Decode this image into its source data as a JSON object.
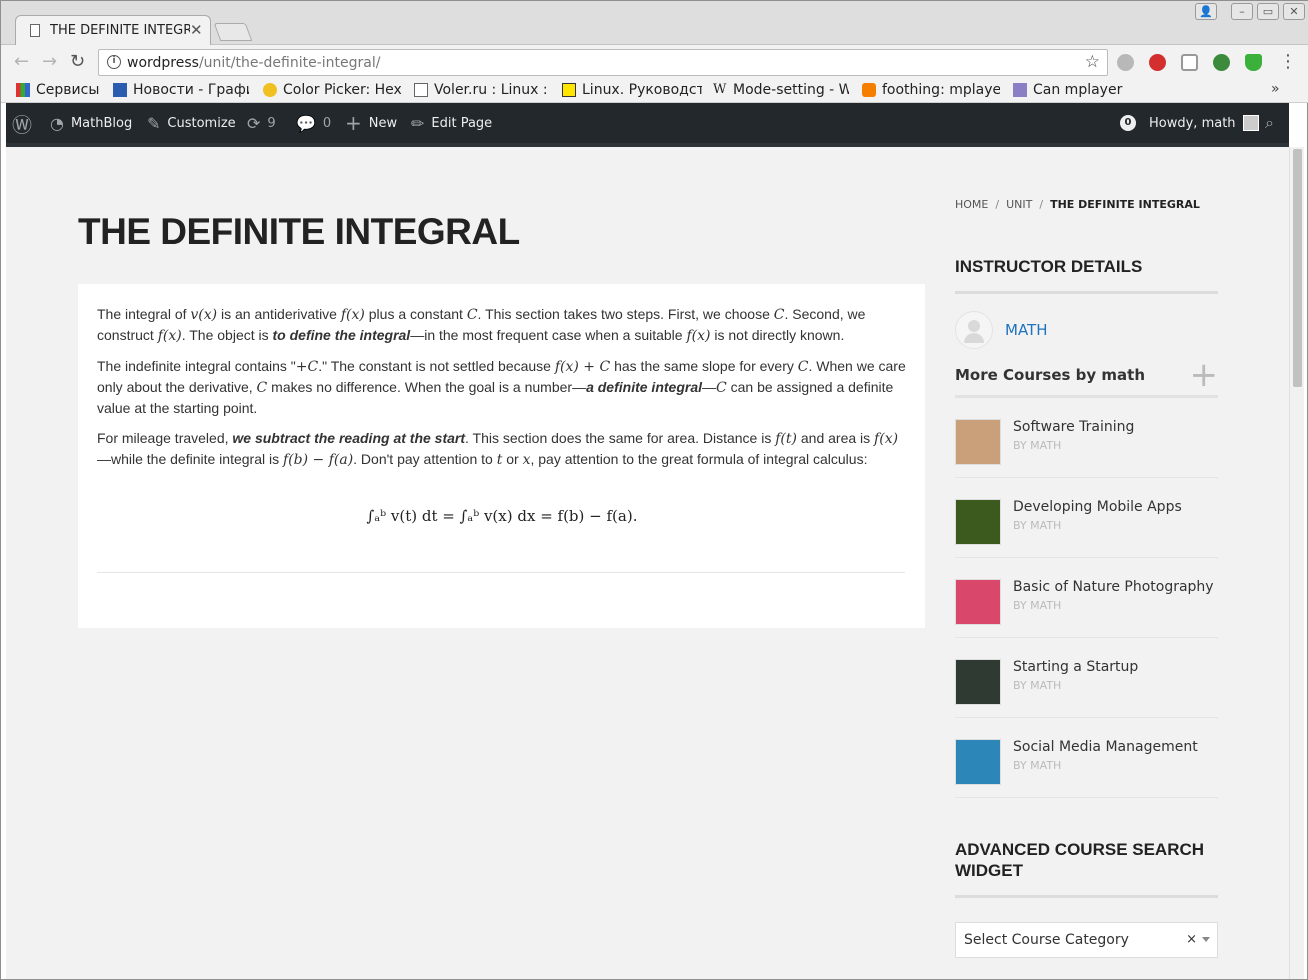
{
  "browser": {
    "tab_title": "THE DEFINITE INTEGRAL",
    "url_host": "wordpress",
    "url_path": "/unit/the-definite-integral/",
    "bookmarks": [
      {
        "label": "Сервисы",
        "icon": "apps-grid-icon"
      },
      {
        "label": "Новости - Графи",
        "icon": "news-icon"
      },
      {
        "label": "Color Picker: Hex",
        "icon": "color-picker-icon"
      },
      {
        "label": "Voler.ru : Linux : I",
        "icon": "page-icon"
      },
      {
        "label": "Linux. Руководст",
        "icon": "linux-l-icon"
      },
      {
        "label": "Mode-setting - W",
        "icon": "wikipedia-icon"
      },
      {
        "label": "foothing: mplaye",
        "icon": "blogger-icon"
      },
      {
        "label": "Can mplayer play",
        "icon": "page-icon"
      }
    ]
  },
  "adminbar": {
    "site_name": "MathBlog",
    "customize": "Customize",
    "updates_count": "9",
    "comments_count": "0",
    "new_label": "New",
    "edit_label": "Edit Page",
    "notifications_count": "0",
    "howdy": "Howdy, math"
  },
  "page": {
    "title": "THE DEFINITE INTEGRAL",
    "breadcrumb": {
      "home": "HOME",
      "unit": "UNIT",
      "current": "THE DEFINITE INTEGRAL"
    },
    "content": {
      "p1": {
        "t1": "The integral of ",
        "m1": "v(x)",
        "t2": " is an antiderivative ",
        "m2": "f(x)",
        "t3": " plus a constant ",
        "m3": "C",
        "t4": ". This section takes two steps. First, we choose ",
        "m4": "C",
        "t5": ". Second, we construct ",
        "m5": "f(x)",
        "t6": ". The object is ",
        "em1": "to define the integral",
        "t7": "—in the most frequent case when a suitable ",
        "m6": "f(x)",
        "t8": " is not directly known."
      },
      "p2": {
        "t1": "The indefinite integral contains \"",
        "m1": "+C",
        "t2": ".\" The constant is not settled because ",
        "m2": "f(x) + C",
        "t3": " has the same slope for every ",
        "m3": "C",
        "t4": ". When we care only about the derivative, ",
        "m4": "C",
        "t5": " makes no difference. When the goal is a number—",
        "em1": "a definite integral",
        "t6": "—",
        "m5": "C",
        "t7": " can be assigned a definite value at the starting point."
      },
      "p3": {
        "t1": "For mileage traveled, ",
        "em1": "we subtract the reading at the start",
        "t2": ". This section does the same for area. Distance is ",
        "m1": "f(t)",
        "t3": " and area is ",
        "m2": "f(x)",
        "t4": "—while the definite integral is ",
        "m3": "f(b) − f(a)",
        "t5": ". Don't pay attention to ",
        "m4": "t",
        "t6": " or ",
        "m5": "x",
        "t7": ", pay attention to the great formula of integral calculus:"
      },
      "formula": "∫ₐᵇ v(t) dt = ∫ₐᵇ v(x) dx = f(b) − f(a)."
    }
  },
  "sidebar": {
    "instructor_title": "INSTRUCTOR DETAILS",
    "instructor_name": "MATH",
    "more_courses_title": "More Courses by math",
    "courses": [
      {
        "title": "Software Training",
        "by": "BY MATH",
        "color": "#c9a07a"
      },
      {
        "title": "Developing Mobile Apps",
        "by": "BY MATH",
        "color": "#3d5a1e"
      },
      {
        "title": "Basic of Nature Photography",
        "by": "BY MATH",
        "color": "#d9486a"
      },
      {
        "title": "Starting a Startup",
        "by": "BY MATH",
        "color": "#2f3a33"
      },
      {
        "title": "Social Media Management",
        "by": "BY MATH",
        "color": "#2d86b8"
      }
    ],
    "search_title": "ADVANCED COURSE SEARCH WIDGET",
    "select_placeholder": "Select Course Category",
    "select_clear": "×"
  },
  "colors": {
    "adminbar_bg": "#23282d",
    "link_blue": "#1e73be",
    "page_bg": "#f2f2f2"
  }
}
